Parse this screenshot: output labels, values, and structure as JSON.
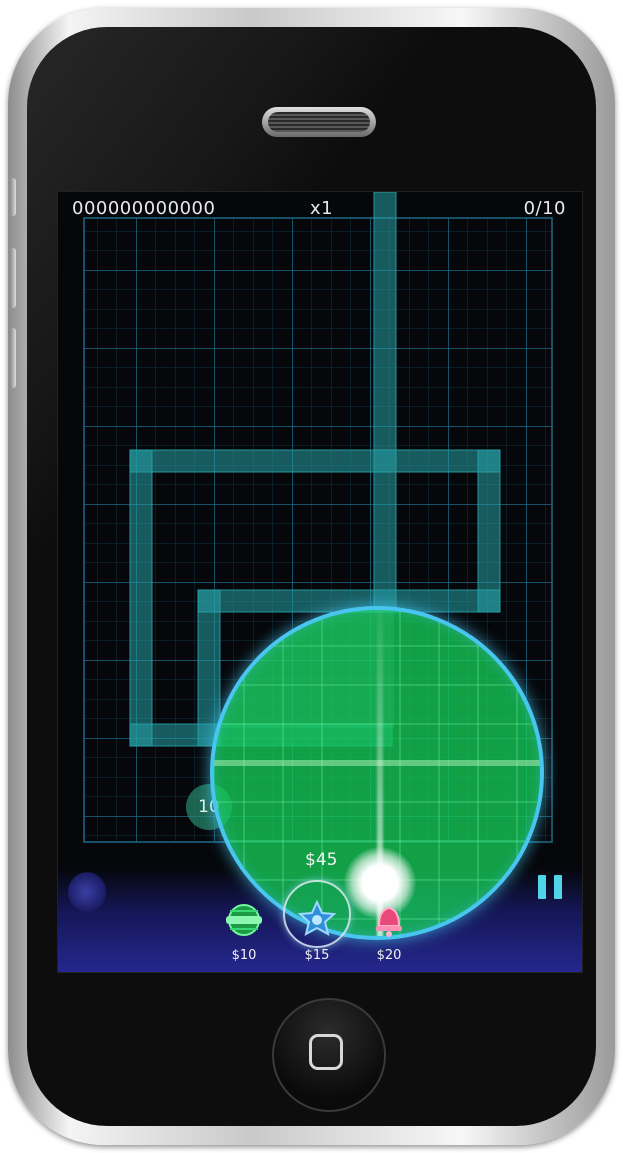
{
  "device": {
    "type": "phone"
  },
  "hud": {
    "score": "000000000000",
    "multiplier": "x1",
    "wave": "0/10"
  },
  "board": {
    "node_label": "10",
    "colors": {
      "grid": "#1d6a86",
      "path": "#27a1a6",
      "range": "#16cc58",
      "range_border": "#49c6f0"
    }
  },
  "tower_preview": {
    "cost": "$45"
  },
  "shop": {
    "items": [
      {
        "price": "$10",
        "icon": "striped-ball-icon",
        "color": "#2fc05b"
      },
      {
        "price": "$15",
        "icon": "star-gear-icon",
        "color": "#2f8fd9",
        "selected": true
      },
      {
        "price": "$20",
        "icon": "bell-icon",
        "color": "#e8487a"
      }
    ]
  },
  "controls": {
    "pause_icon": "pause-icon",
    "menu_icon": "moon-icon"
  }
}
